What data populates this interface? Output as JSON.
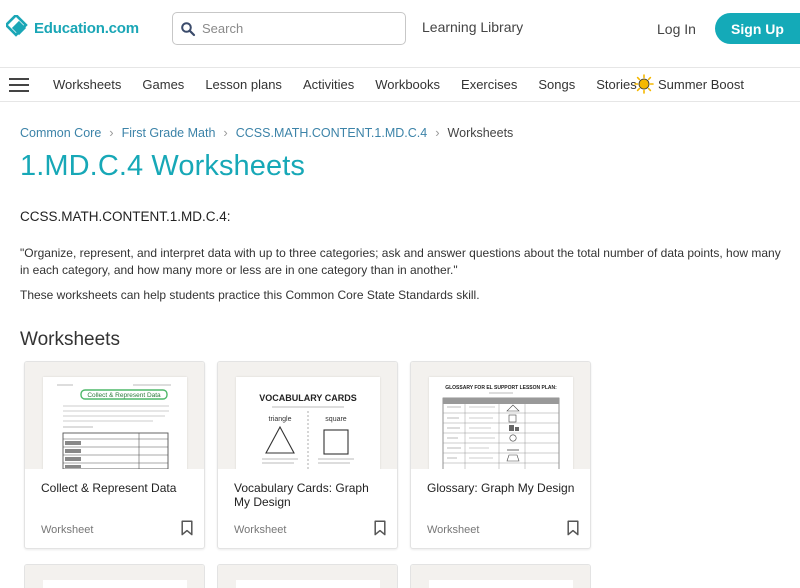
{
  "header": {
    "logo_text": "Education.com",
    "search_placeholder": "Search",
    "learning_library": "Learning Library",
    "login": "Log In",
    "signup": "Sign Up"
  },
  "nav": {
    "items": [
      "Worksheets",
      "Games",
      "Lesson plans",
      "Activities",
      "Workbooks",
      "Exercises",
      "Songs",
      "Stories"
    ],
    "summer_boost": "Summer Boost"
  },
  "breadcrumb": {
    "items": [
      "Common Core",
      "First Grade Math",
      "CCSS.MATH.CONTENT.1.MD.C.4"
    ],
    "current": "Worksheets"
  },
  "page": {
    "title": "1.MD.C.4 Worksheets",
    "standard_code": "CCSS.MATH.CONTENT.1.MD.C.4",
    "standard_suffix": ":",
    "description": "\"Organize, represent, and interpret data with up to three categories; ask and answer questions about the total number of data points, how many in each category, and how many more or less are in one category than in another.\"",
    "help_text": "These worksheets can help students practice this Common Core State Standards skill.",
    "section_title": "Worksheets"
  },
  "cards": [
    {
      "title": "Collect & Represent Data",
      "type": "Worksheet",
      "thumb_heading": "Collect & Represent Data"
    },
    {
      "title": "Vocabulary Cards: Graph My Design",
      "type": "Worksheet",
      "thumb_heading": "VOCABULARY CARDS",
      "thumb_word_1": "triangle",
      "thumb_word_2": "square"
    },
    {
      "title": "Glossary: Graph My Design",
      "type": "Worksheet",
      "thumb_heading": "GLOSSARY FOR EL SUPPORT LESSON PLAN:"
    }
  ],
  "colors": {
    "brand": "#14aab8",
    "title": "#17a8b7",
    "link": "#3c83a8",
    "sun": "#f6b800"
  }
}
